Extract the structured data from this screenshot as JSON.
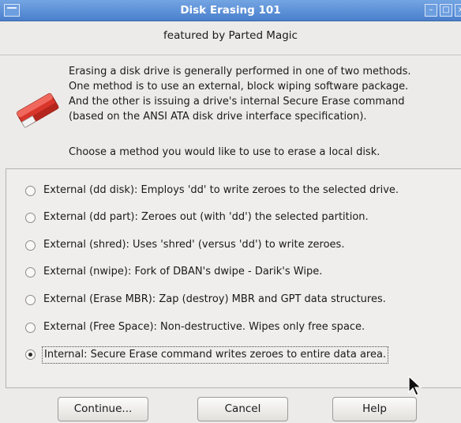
{
  "window": {
    "title": "Disk Erasing 101",
    "controls": [
      "minimize",
      "maximize",
      "close"
    ]
  },
  "header": {
    "subtitle": "featured by Parted Magic",
    "icon": "eraser-icon"
  },
  "intro": {
    "lines": [
      "Erasing a disk drive is generally performed in one of two methods.",
      "One method is to use an external, block wiping software package.",
      "And the other is issuing a drive's internal Secure Erase command",
      "(based on the ANSI ATA disk drive interface specification)."
    ],
    "prompt": "Choose a method you would like to use to erase a local disk."
  },
  "options": [
    {
      "label": "External (dd disk): Employs 'dd' to write zeroes to the selected drive.",
      "selected": false
    },
    {
      "label": "External (dd part): Zeroes out (with 'dd') the selected partition.",
      "selected": false
    },
    {
      "label": "External (shred): Uses 'shred' (versus 'dd') to write zeroes.",
      "selected": false
    },
    {
      "label": "External (nwipe): Fork of DBAN's dwipe - Darik's Wipe.",
      "selected": false
    },
    {
      "label": "External (Erase MBR): Zap (destroy) MBR and GPT data structures.",
      "selected": false
    },
    {
      "label": "External (Free Space): Non-destructive. Wipes only free space.",
      "selected": false
    },
    {
      "label": "Internal: Secure Erase command writes zeroes to entire data area.",
      "selected": true
    }
  ],
  "buttons": {
    "continue": "Continue...",
    "cancel": "Cancel",
    "help": "Help"
  },
  "colors": {
    "titlebar": "#5b8fd8",
    "window_bg": "#ecebe9",
    "eraser_red": "#d9362b"
  }
}
